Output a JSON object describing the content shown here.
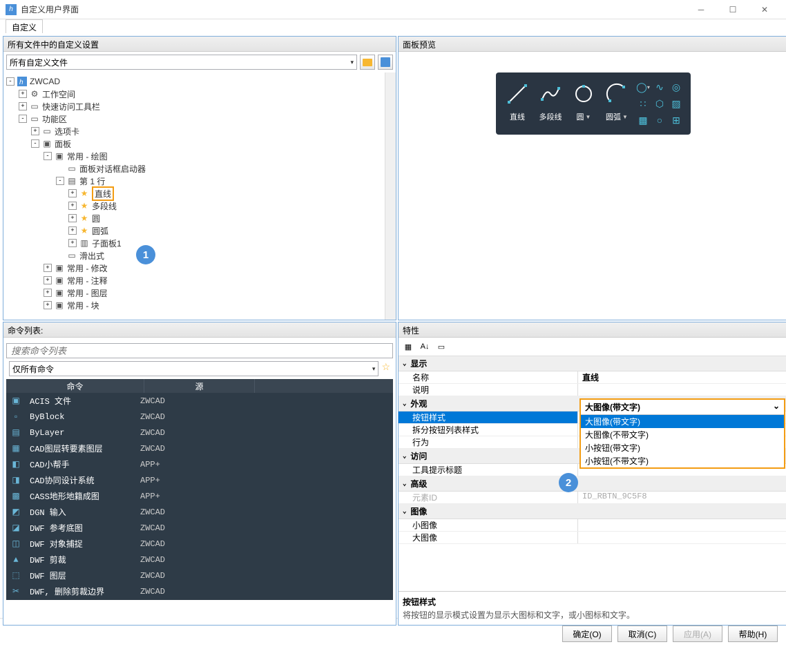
{
  "window": {
    "title": "自定义用户界面"
  },
  "tab": {
    "label": "自定义"
  },
  "topLeft": {
    "title": "所有文件中的自定义设置",
    "dropdown": "所有自定义文件",
    "tree": [
      {
        "depth": 0,
        "toggle": "-",
        "icon": "app",
        "label": "ZWCAD"
      },
      {
        "depth": 1,
        "toggle": "+",
        "icon": "gear",
        "label": "工作空间"
      },
      {
        "depth": 1,
        "toggle": "+",
        "icon": "toolbar",
        "label": "快速访问工具栏"
      },
      {
        "depth": 1,
        "toggle": "-",
        "icon": "ribbon",
        "label": "功能区"
      },
      {
        "depth": 2,
        "toggle": "+",
        "icon": "tab",
        "label": "选项卡"
      },
      {
        "depth": 2,
        "toggle": "-",
        "icon": "panel",
        "label": "面板"
      },
      {
        "depth": 3,
        "toggle": "-",
        "icon": "panel",
        "label": "常用 - 绘图"
      },
      {
        "depth": 4,
        "toggle": "",
        "icon": "dialog",
        "label": "面板对话框启动器"
      },
      {
        "depth": 4,
        "toggle": "-",
        "icon": "row",
        "label": "第 1 行"
      },
      {
        "depth": 5,
        "toggle": "+",
        "icon": "star",
        "label": "直线",
        "highlight": true
      },
      {
        "depth": 5,
        "toggle": "+",
        "icon": "star",
        "label": "多段线"
      },
      {
        "depth": 5,
        "toggle": "+",
        "icon": "star",
        "label": "圆"
      },
      {
        "depth": 5,
        "toggle": "+",
        "icon": "star",
        "label": "圆弧"
      },
      {
        "depth": 5,
        "toggle": "+",
        "icon": "subpanel",
        "label": "子面板1"
      },
      {
        "depth": 4,
        "toggle": "",
        "icon": "slideout",
        "label": "滑出式"
      },
      {
        "depth": 3,
        "toggle": "+",
        "icon": "panel",
        "label": "常用 - 修改"
      },
      {
        "depth": 3,
        "toggle": "+",
        "icon": "panel",
        "label": "常用 - 注释"
      },
      {
        "depth": 3,
        "toggle": "+",
        "icon": "panel",
        "label": "常用 - 图层"
      },
      {
        "depth": 3,
        "toggle": "+",
        "icon": "panel",
        "label": "常用 - 块"
      }
    ],
    "callout1": "1"
  },
  "topRight": {
    "title": "面板预览",
    "labels": [
      "直线",
      "多段线",
      "圆",
      "圆弧"
    ]
  },
  "bottomLeft": {
    "title": "命令列表:",
    "searchPlaceholder": "搜索命令列表",
    "filter": "仅所有命令",
    "headers": {
      "cmd": "命令",
      "src": "源"
    },
    "rows": [
      {
        "name": "ACIS 文件",
        "src": "ZWCAD"
      },
      {
        "name": "ByBlock",
        "src": "ZWCAD"
      },
      {
        "name": "ByLayer",
        "src": "ZWCAD"
      },
      {
        "name": "CAD图层转要素图层",
        "src": "ZWCAD"
      },
      {
        "name": "CAD小帮手",
        "src": "APP+"
      },
      {
        "name": "CAD协同设计系统",
        "src": "APP+"
      },
      {
        "name": "CASS地形地籍成图",
        "src": "APP+"
      },
      {
        "name": "DGN 输入",
        "src": "ZWCAD"
      },
      {
        "name": "DWF 参考底图",
        "src": "ZWCAD"
      },
      {
        "name": "DWF 对象捕捉",
        "src": "ZWCAD"
      },
      {
        "name": "DWF 剪裁",
        "src": "ZWCAD"
      },
      {
        "name": "DWF 图层",
        "src": "ZWCAD"
      },
      {
        "name": "DWF, 删除剪裁边界",
        "src": "ZWCAD"
      }
    ]
  },
  "bottomRight": {
    "title": "特性",
    "cats": {
      "display": "显示",
      "name": "名称",
      "nameVal": "直线",
      "desc": "说明",
      "appearance": "外观",
      "btnStyle": "按钮样式",
      "btnStyleVal": "大图像(带文字)",
      "splitStyle": "拆分按钮列表样式",
      "behavior": "行为",
      "access": "访问",
      "tooltip": "工具提示标题",
      "advanced": "高级",
      "elemId": "元素ID",
      "elemIdVal": "ID_RBTN_9C5F8",
      "image": "图像",
      "smallImg": "小图像",
      "bigImg": "大图像"
    },
    "dropdown": {
      "header": "大图像(带文字)",
      "items": [
        "大图像(带文字)",
        "大图像(不带文字)",
        "小按钮(带文字)",
        "小按钮(不带文字)"
      ]
    },
    "callout2": "2",
    "footer": {
      "title": "按钮样式",
      "desc": "将按钮的显示模式设置为显示大图标和文字，或小图标和文字。"
    }
  },
  "buttons": {
    "ok": "确定(O)",
    "cancel": "取消(C)",
    "apply": "应用(A)",
    "help": "帮助(H)"
  }
}
